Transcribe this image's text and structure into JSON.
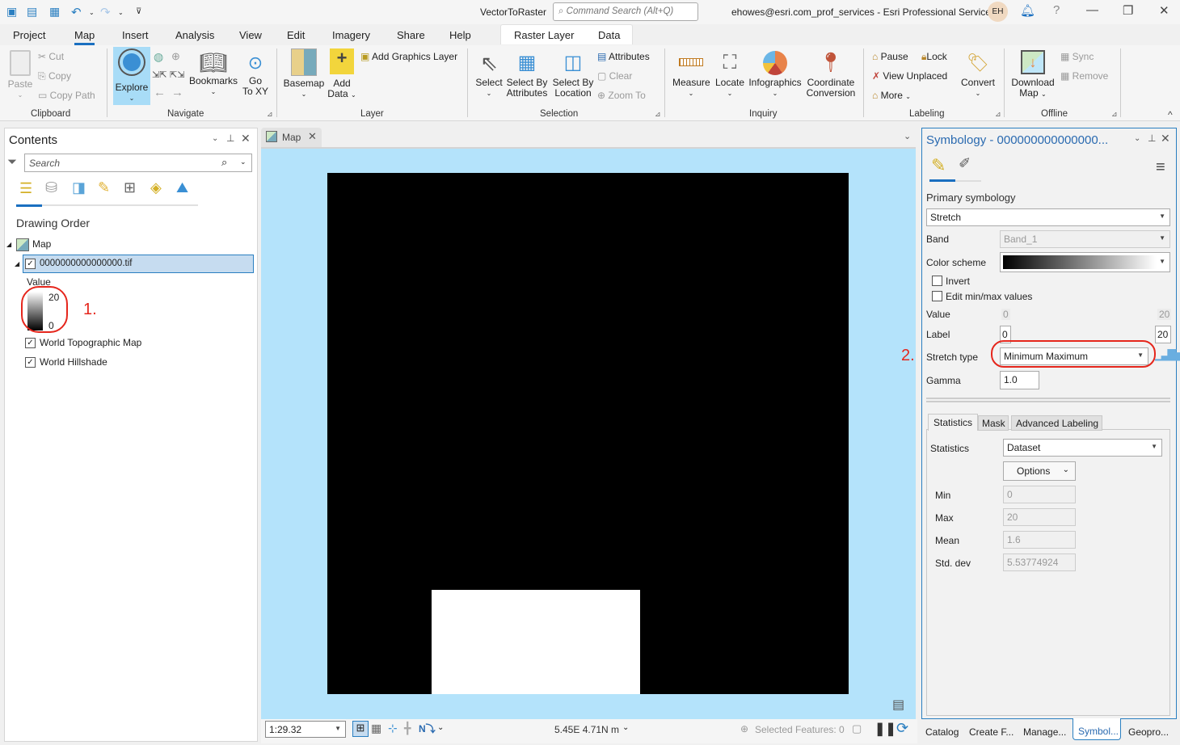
{
  "app": {
    "project_title": "VectorToRaster",
    "command_search_placeholder": "Command Search (Alt+Q)",
    "user": "ehowes@esri.com_prof_services - Esri Professional Services",
    "avatar_initials": "EH",
    "help": "?",
    "minimize": "—",
    "restore": "❐",
    "close": "✕"
  },
  "ribbon_tabs": [
    "Project",
    "Map",
    "Insert",
    "Analysis",
    "View",
    "Edit",
    "Imagery",
    "Share",
    "Help"
  ],
  "active_tab": "Map",
  "contextual_tabs": [
    "Raster Layer",
    "Data"
  ],
  "ribbon": {
    "clipboard": {
      "label": "Clipboard",
      "paste": "Paste",
      "cut": "Cut",
      "copy": "Copy",
      "copy_path": "Copy Path"
    },
    "navigate": {
      "label": "Navigate",
      "explore": "Explore",
      "bookmarks": "Bookmarks",
      "go_to_xy": "Go\nTo XY",
      "go": "Go",
      "to_xy": "To XY"
    },
    "layer": {
      "label": "Layer",
      "basemap": "Basemap",
      "add_data": "Add",
      "add_data2": "Data",
      "add_graphics_layer": "Add Graphics Layer"
    },
    "selection": {
      "label": "Selection",
      "select": "Select",
      "select_by_attr1": "Select By",
      "select_by_attr2": "Attributes",
      "select_by_loc1": "Select By",
      "select_by_loc2": "Location",
      "attributes": "Attributes",
      "clear": "Clear",
      "zoom_to": "Zoom To"
    },
    "inquiry": {
      "label": "Inquiry",
      "measure": "Measure",
      "locate": "Locate",
      "infographics": "Infographics",
      "coord1": "Coordinate",
      "coord2": "Conversion"
    },
    "labeling": {
      "label": "Labeling",
      "pause": "Pause",
      "lock": "Lock",
      "view_unplaced": "View Unplaced",
      "more": "More",
      "convert": "Convert"
    },
    "offline": {
      "label": "Offline",
      "download1": "Download",
      "download2": "Map",
      "sync": "Sync",
      "remove": "Remove"
    }
  },
  "contents": {
    "title": "Contents",
    "search_placeholder": "Search",
    "drawing_order": "Drawing Order",
    "map_label": "Map",
    "layer_name": "0000000000000000.tif",
    "legend_title": "Value",
    "legend_max": "20",
    "legend_min": "0",
    "annotation_1": "1.",
    "layers": [
      {
        "name": "World Topographic Map",
        "checked": true
      },
      {
        "name": "World Hillshade",
        "checked": true
      }
    ]
  },
  "map": {
    "tab_label": "Map",
    "scale": "1:29.32",
    "coordinates": "5.45E 4.71N m",
    "selected_features": "Selected Features: 0"
  },
  "symbology": {
    "title": "Symbology - 000000000000000...",
    "primary_label": "Primary symbology",
    "renderer": "Stretch",
    "band_label": "Band",
    "band_value": "Band_1",
    "color_scheme_label": "Color scheme",
    "invert_label": "Invert",
    "invert_checked": false,
    "edit_minmax_label": "Edit min/max values",
    "edit_minmax_checked": false,
    "value_label": "Value",
    "value_min": "0",
    "value_max": "20",
    "label_label": "Label",
    "label_min": "0",
    "label_max": "20",
    "stretch_type_label": "Stretch type",
    "stretch_type": "Minimum Maximum",
    "annotation_2": "2.",
    "gamma_label": "Gamma",
    "gamma": "1.0",
    "tabs": [
      "Statistics",
      "Mask",
      "Advanced Labeling"
    ],
    "active_tab": "Statistics",
    "statistics_label": "Statistics",
    "statistics_value": "Dataset",
    "options_label": "Options",
    "stats": [
      {
        "label": "Min",
        "value": "0"
      },
      {
        "label": "Max",
        "value": "20"
      },
      {
        "label": "Mean",
        "value": "1.6"
      },
      {
        "label": "Std. dev",
        "value": "5.53774924"
      }
    ]
  },
  "bottom_tabs": [
    "Catalog",
    "Create F...",
    "Manage...",
    "Symbol...",
    "Geopro..."
  ],
  "active_bottom_tab": "Symbol..."
}
